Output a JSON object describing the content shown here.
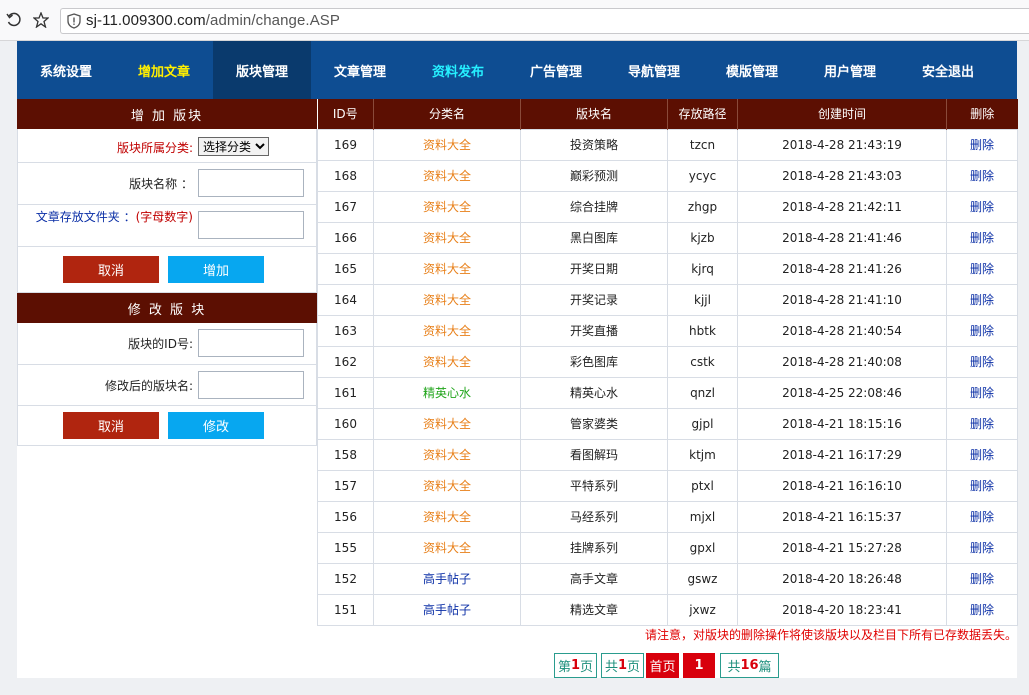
{
  "browser": {
    "url_host": "sj-11.009300.com",
    "url_path": "/admin/change.ASP"
  },
  "nav": [
    {
      "label": "系统设置",
      "style": "normal"
    },
    {
      "label": "增加文章",
      "style": "yellow"
    },
    {
      "label": "版块管理",
      "style": "active"
    },
    {
      "label": "文章管理",
      "style": "normal"
    },
    {
      "label": "资料发布",
      "style": "cyan"
    },
    {
      "label": "广告管理",
      "style": "normal"
    },
    {
      "label": "导航管理",
      "style": "normal"
    },
    {
      "label": "模版管理",
      "style": "normal"
    },
    {
      "label": "用户管理",
      "style": "normal"
    },
    {
      "label": "安全退出",
      "style": "normal"
    }
  ],
  "add_panel": {
    "title": "增 加 版块",
    "category_label": "版块所属分类:",
    "category_select": "选择分类",
    "name_label": "版块名称 ：",
    "folder_label": "文章存放文件夹 ：",
    "folder_hint": "(字母数字)",
    "cancel": "取消",
    "submit": "增加"
  },
  "edit_panel": {
    "title": "修 改 版 块",
    "id_label": "版块的ID号:",
    "newname_label": "修改后的版块名:",
    "cancel": "取消",
    "submit": "修改"
  },
  "table": {
    "headers": [
      "ID号",
      "分类名",
      "版块名",
      "存放路径",
      "创建时间",
      "删除"
    ],
    "rows": [
      {
        "id": "169",
        "cat": "资料大全",
        "cat_color": "orange",
        "name": "投资策略",
        "path": "tzcn",
        "time": "2018-4-28 21:43:19",
        "del": "删除"
      },
      {
        "id": "168",
        "cat": "资料大全",
        "cat_color": "orange",
        "name": "巅彩预测",
        "path": "ycyc",
        "time": "2018-4-28 21:43:03",
        "del": "删除"
      },
      {
        "id": "167",
        "cat": "资料大全",
        "cat_color": "orange",
        "name": "综合挂牌",
        "path": "zhgp",
        "time": "2018-4-28 21:42:11",
        "del": "删除"
      },
      {
        "id": "166",
        "cat": "资料大全",
        "cat_color": "orange",
        "name": "黑白图库",
        "path": "kjzb",
        "time": "2018-4-28 21:41:46",
        "del": "删除"
      },
      {
        "id": "165",
        "cat": "资料大全",
        "cat_color": "orange",
        "name": "开奖日期",
        "path": "kjrq",
        "time": "2018-4-28 21:41:26",
        "del": "删除"
      },
      {
        "id": "164",
        "cat": "资料大全",
        "cat_color": "orange",
        "name": "开奖记录",
        "path": "kjjl",
        "time": "2018-4-28 21:41:10",
        "del": "删除"
      },
      {
        "id": "163",
        "cat": "资料大全",
        "cat_color": "orange",
        "name": "开奖直播",
        "path": "hbtk",
        "time": "2018-4-28 21:40:54",
        "del": "删除"
      },
      {
        "id": "162",
        "cat": "资料大全",
        "cat_color": "orange",
        "name": "彩色图库",
        "path": "cstk",
        "time": "2018-4-28 21:40:08",
        "del": "删除"
      },
      {
        "id": "161",
        "cat": "精英心水",
        "cat_color": "green",
        "name": "精英心水",
        "path": "qnzl",
        "time": "2018-4-25 22:08:46",
        "del": "删除"
      },
      {
        "id": "160",
        "cat": "资料大全",
        "cat_color": "orange",
        "name": "管家婆类",
        "path": "gjpl",
        "time": "2018-4-21 18:15:16",
        "del": "删除"
      },
      {
        "id": "158",
        "cat": "资料大全",
        "cat_color": "orange",
        "name": "看图解玛",
        "path": "ktjm",
        "time": "2018-4-21 16:17:29",
        "del": "删除"
      },
      {
        "id": "157",
        "cat": "资料大全",
        "cat_color": "orange",
        "name": "平特系列",
        "path": "ptxl",
        "time": "2018-4-21 16:16:10",
        "del": "删除"
      },
      {
        "id": "156",
        "cat": "资料大全",
        "cat_color": "orange",
        "name": "马经系列",
        "path": "mjxl",
        "time": "2018-4-21 16:15:37",
        "del": "删除"
      },
      {
        "id": "155",
        "cat": "资料大全",
        "cat_color": "orange",
        "name": "挂牌系列",
        "path": "gpxl",
        "time": "2018-4-21 15:27:28",
        "del": "删除"
      },
      {
        "id": "152",
        "cat": "高手帖子",
        "cat_color": "navy",
        "name": "高手文章",
        "path": "gswz",
        "time": "2018-4-20 18:26:48",
        "del": "删除"
      },
      {
        "id": "151",
        "cat": "高手帖子",
        "cat_color": "navy",
        "name": "精选文章",
        "path": "jxwz",
        "time": "2018-4-20 18:23:41",
        "del": "删除"
      }
    ]
  },
  "warning": "请注意，对版块的删除操作将使该版块以及栏目下所有已存数据丢失。",
  "pager": {
    "page_prefix": "第",
    "page_num": "1",
    "page_suffix": "页",
    "total_prefix": "共",
    "total_num": "1",
    "total_suffix": "页",
    "first": "首页",
    "current": "1",
    "count_prefix": "共",
    "count_num": "16",
    "count_suffix": "篇"
  },
  "colors": {
    "nav_bg": "#0e4d92",
    "header_bg": "#5c0f02",
    "cancel_btn": "#b0250f",
    "submit_btn": "#07a7f0"
  }
}
